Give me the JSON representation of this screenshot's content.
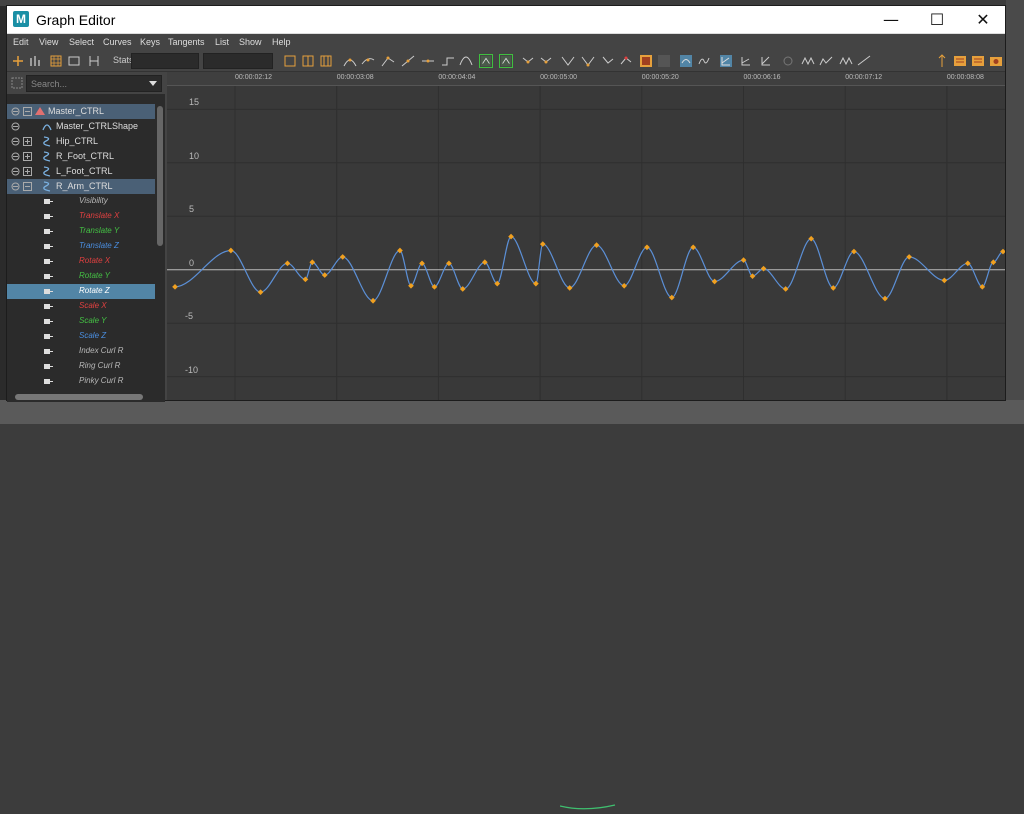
{
  "window": {
    "title": "Graph Editor",
    "app_icon_letter": "M"
  },
  "controls": {
    "minimize": "—",
    "maximize": "☐",
    "close": "✕"
  },
  "menu": [
    "Edit",
    "View",
    "Select",
    "Curves",
    "Keys",
    "Tangents",
    "List",
    "Show",
    "Help"
  ],
  "toolbar": {
    "stats_label": "Stats"
  },
  "search": {
    "placeholder": "Search..."
  },
  "outliner": {
    "nodes": [
      {
        "label": "Master_CTRL",
        "kind": "object",
        "color": "#dddddd"
      },
      {
        "label": "Master_CTRLShape",
        "kind": "shape",
        "color": "#dddddd"
      },
      {
        "label": "Hip_CTRL",
        "kind": "object",
        "color": "#dddddd"
      },
      {
        "label": "R_Foot_CTRL",
        "kind": "object",
        "color": "#dddddd"
      },
      {
        "label": "L_Foot_CTRL",
        "kind": "object",
        "color": "#dddddd"
      },
      {
        "label": "R_Arm_CTRL",
        "kind": "object",
        "color": "#dddddd"
      }
    ],
    "channels": [
      {
        "label": "Visibility",
        "color": "#b8b8b8"
      },
      {
        "label": "Translate X",
        "color": "#e04040"
      },
      {
        "label": "Translate Y",
        "color": "#44c044"
      },
      {
        "label": "Translate Z",
        "color": "#4a8ee0"
      },
      {
        "label": "Rotate X",
        "color": "#e04040"
      },
      {
        "label": "Rotate Y",
        "color": "#44c044"
      },
      {
        "label": "Rotate Z",
        "color": "#ffffff"
      },
      {
        "label": "Scale X",
        "color": "#e04040"
      },
      {
        "label": "Scale Y",
        "color": "#44c044"
      },
      {
        "label": "Scale Z",
        "color": "#4a8ee0"
      },
      {
        "label": "Index Curl R",
        "color": "#b8b8b8"
      },
      {
        "label": "Ring Curl R",
        "color": "#b8b8b8"
      },
      {
        "label": "Pinky Curl R",
        "color": "#b8b8b8"
      }
    ],
    "selected_channel": "Rotate Z"
  },
  "graph": {
    "time_labels": [
      "00:00:02:12",
      "00:00:03:08",
      "00:00:04:04",
      "00:00:05:00",
      "00:00:05:20",
      "00:00:06:16",
      "00:00:07:12",
      "00:00:08:08"
    ],
    "value_labels": [
      "15",
      "10",
      "5",
      "0",
      "-5",
      "-10"
    ],
    "value_ticks": [
      15,
      10,
      5,
      0,
      -5,
      -10
    ],
    "ylim": [
      -10.5,
      15.5
    ],
    "tlim": [
      0,
      100
    ],
    "curve_color": "#5b8fd6",
    "key_color": "#f0a020",
    "keys": [
      [
        0.0,
        -1.6
      ],
      [
        8.1,
        1.8
      ],
      [
        12.4,
        -2.1
      ],
      [
        16.3,
        0.6
      ],
      [
        18.9,
        -0.9
      ],
      [
        19.9,
        0.7
      ],
      [
        21.7,
        -0.5
      ],
      [
        24.3,
        1.2
      ],
      [
        28.7,
        -2.9
      ],
      [
        32.6,
        1.8
      ],
      [
        34.2,
        -1.5
      ],
      [
        35.8,
        0.6
      ],
      [
        37.6,
        -1.6
      ],
      [
        39.7,
        0.6
      ],
      [
        41.7,
        -1.8
      ],
      [
        44.9,
        0.7
      ],
      [
        46.7,
        -1.3
      ],
      [
        48.7,
        3.1
      ],
      [
        52.3,
        -1.3
      ],
      [
        53.3,
        2.4
      ],
      [
        57.2,
        -1.7
      ],
      [
        61.1,
        2.3
      ],
      [
        65.1,
        -1.5
      ],
      [
        68.4,
        2.1
      ],
      [
        72.0,
        -2.6
      ],
      [
        75.1,
        2.1
      ],
      [
        78.2,
        -1.1
      ],
      [
        82.4,
        0.9
      ],
      [
        83.7,
        -0.6
      ],
      [
        85.3,
        0.1
      ],
      [
        88.5,
        -1.8
      ],
      [
        92.2,
        2.9
      ],
      [
        95.4,
        -1.7
      ],
      [
        98.4,
        1.7
      ],
      [
        102.9,
        -2.7
      ],
      [
        106.4,
        1.2
      ],
      [
        111.5,
        -1.0
      ],
      [
        114.9,
        0.6
      ],
      [
        117.0,
        -1.6
      ],
      [
        118.6,
        0.7
      ],
      [
        120.0,
        1.7
      ]
    ]
  }
}
